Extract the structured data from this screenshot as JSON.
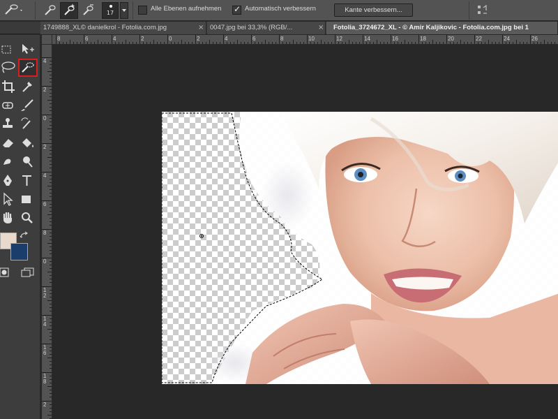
{
  "options_bar": {
    "brush_size": "17",
    "sample_all_layers_label": "Alle Ebenen aufnehmen",
    "sample_all_layers_checked": false,
    "auto_enhance_label": "Automatisch verbessern",
    "auto_enhance_checked": true,
    "auto_enhance_mark": "✓",
    "refine_edge_label": "Kante verbessern..."
  },
  "tabs": [
    {
      "label": "1749888_XL© danielkrol - Fotolia.com.jpg",
      "close": "×",
      "active": false
    },
    {
      "label": "0047.jpg bei 33,3% (RGB/...",
      "close": "×",
      "active": false
    },
    {
      "label": "Fotolia_3724672_XL - © Amir Kaljikovic - Fotolia.com.jpg bei 1",
      "close": "",
      "active": true
    }
  ],
  "ruler_h_labels": [
    "8",
    "6",
    "4",
    "2",
    "0",
    "2",
    "4",
    "6",
    "8",
    "10",
    "12",
    "14",
    "16",
    "18",
    "20",
    "22",
    "24",
    "26"
  ],
  "ruler_v_labels": [
    "4",
    "2",
    "0",
    "2",
    "4",
    "6",
    "8",
    "0",
    "1 2",
    "1 4",
    "1 6",
    "1 8",
    "2"
  ],
  "tool_icons": [
    "marquee-icon",
    "move-icon",
    "lasso-icon",
    "quick-selection-icon",
    "crop-icon",
    "eyedropper-icon",
    "healing-brush-icon",
    "brush-icon",
    "clone-stamp-icon",
    "history-brush-icon",
    "eraser-icon",
    "paint-bucket-icon",
    "smudge-icon",
    "dodge-icon",
    "pen-icon",
    "type-icon",
    "path-selection-icon",
    "rectangle-icon",
    "hand-icon",
    "zoom-icon"
  ],
  "colors": {
    "foreground": "#e9d9cc",
    "background": "#1a3d6c",
    "active_tool_highlight": "#d81e1e"
  }
}
